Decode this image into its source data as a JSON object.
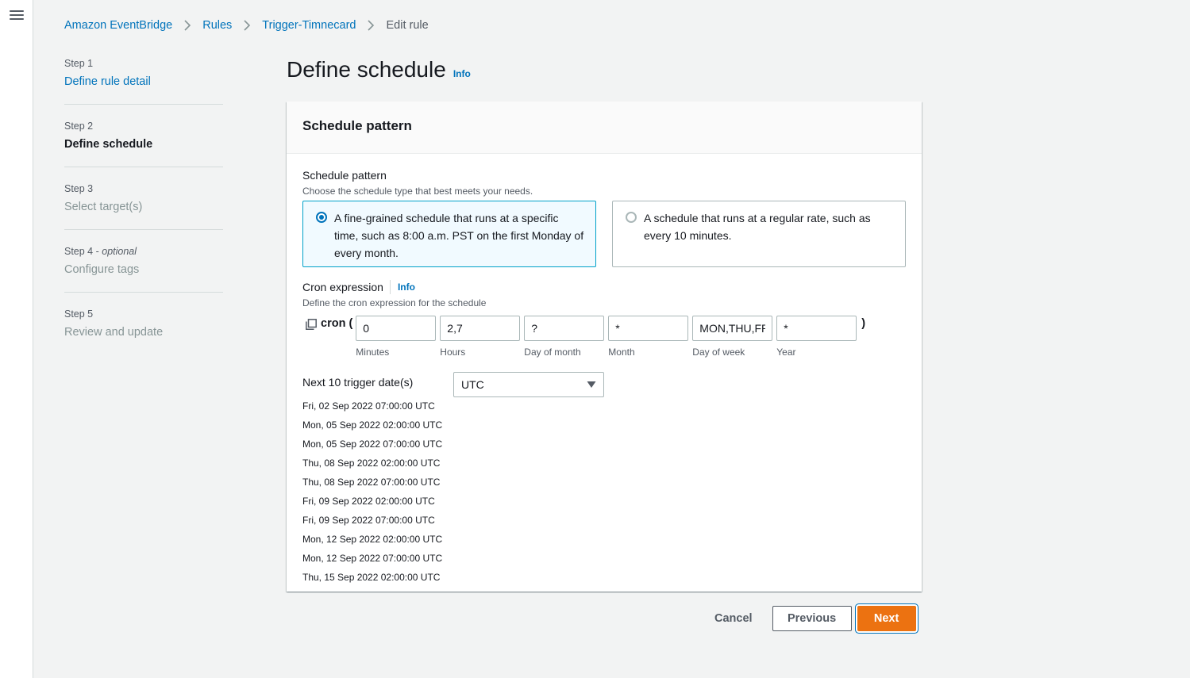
{
  "breadcrumbs": [
    {
      "label": "Amazon EventBridge"
    },
    {
      "label": "Rules"
    },
    {
      "label": "Trigger-Timnecard"
    },
    {
      "label": "Edit rule"
    }
  ],
  "steps": [
    {
      "num": "Step 1",
      "optional": "",
      "name": "Define rule detail",
      "state": "link"
    },
    {
      "num": "Step 2",
      "optional": "",
      "name": "Define schedule",
      "state": "active"
    },
    {
      "num": "Step 3",
      "optional": "",
      "name": "Select target(s)",
      "state": "disabled"
    },
    {
      "num": "Step 4 - ",
      "optional": "optional",
      "name": "Configure tags",
      "state": "disabled"
    },
    {
      "num": "Step 5",
      "optional": "",
      "name": "Review and update",
      "state": "disabled"
    }
  ],
  "page": {
    "title": "Define schedule",
    "info": "Info"
  },
  "panel": {
    "title": "Schedule pattern",
    "pattern_label": "Schedule pattern",
    "pattern_desc": "Choose the schedule type that best meets your needs.",
    "options": [
      {
        "text": "A fine-grained schedule that runs at a specific time, such as 8:00 a.m. PST on the first Monday of every month.",
        "selected": true
      },
      {
        "text": "A schedule that runs at a regular rate, such as every 10 minutes.",
        "selected": false
      }
    ],
    "cron_label": "Cron expression",
    "cron_info": "Info",
    "cron_desc": "Define the cron expression for the schedule",
    "cron_open": "cron (",
    "cron_close": ")",
    "cron_fields": [
      {
        "value": "0",
        "label": "Minutes"
      },
      {
        "value": "2,7",
        "label": "Hours"
      },
      {
        "value": "?",
        "label": "Day of month"
      },
      {
        "value": "*",
        "label": "Month"
      },
      {
        "value": "MON,THU,FRI",
        "label": "Day of week"
      },
      {
        "value": "*",
        "label": "Year"
      }
    ],
    "next_title": "Next 10 trigger date(s)",
    "timezone": "UTC",
    "trigger_dates": [
      "Fri, 02 Sep 2022 07:00:00 UTC",
      "Mon, 05 Sep 2022 02:00:00 UTC",
      "Mon, 05 Sep 2022 07:00:00 UTC",
      "Thu, 08 Sep 2022 02:00:00 UTC",
      "Thu, 08 Sep 2022 07:00:00 UTC",
      "Fri, 09 Sep 2022 02:00:00 UTC",
      "Fri, 09 Sep 2022 07:00:00 UTC",
      "Mon, 12 Sep 2022 02:00:00 UTC",
      "Mon, 12 Sep 2022 07:00:00 UTC",
      "Thu, 15 Sep 2022 02:00:00 UTC"
    ]
  },
  "actions": {
    "cancel": "Cancel",
    "previous": "Previous",
    "next": "Next"
  },
  "colors": {
    "link": "#0073bb",
    "primary": "#ec7211",
    "selected_border": "#00a1c9",
    "selected_bg": "#f1faff"
  },
  "icons": {
    "menu": "hamburger-menu-icon",
    "separator": "chevron-right-icon",
    "copy": "copy-icon",
    "dropdown": "caret-down-icon"
  }
}
